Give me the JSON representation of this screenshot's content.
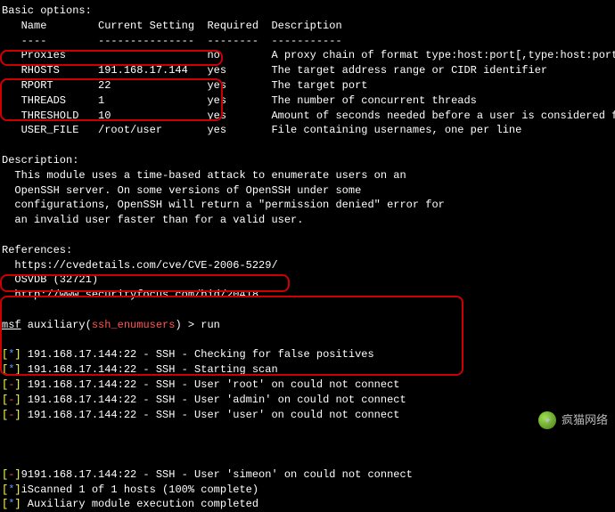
{
  "header": {
    "title": "Basic options:",
    "cols": {
      "name": "Name",
      "setting": "Current Setting",
      "required": "Required",
      "desc": "Description"
    },
    "rule": {
      "name": "----",
      "setting": "---------------",
      "required": "--------",
      "desc": "-----------"
    }
  },
  "options": [
    {
      "name": "Proxies",
      "setting": "",
      "required": "no",
      "desc": "A proxy chain of format type:host:port[,type:host:port][...]"
    },
    {
      "name": "RHOSTS",
      "setting": "191.168.17.144",
      "required": "yes",
      "desc": "The target address range or CIDR identifier"
    },
    {
      "name": "RPORT",
      "setting": "22",
      "required": "yes",
      "desc": "The target port"
    },
    {
      "name": "THREADS",
      "setting": "1",
      "required": "yes",
      "desc": "The number of concurrent threads"
    },
    {
      "name": "THRESHOLD",
      "setting": "10",
      "required": "yes",
      "desc": "Amount of seconds needed before a user is considered found"
    },
    {
      "name": "USER_FILE",
      "setting": "/root/user",
      "required": "yes",
      "desc": "File containing usernames, one per line"
    }
  ],
  "description": {
    "heading": "Description:",
    "lines": [
      "  This module uses a time-based attack to enumerate users on an",
      "  OpenSSH server. On some versions of OpenSSH under some",
      "  configurations, OpenSSH will return a \"permission denied\" error for",
      "  an invalid user faster than for a valid user."
    ]
  },
  "references": {
    "heading": "References:",
    "lines": [
      "  https://cvedetails.com/cve/CVE-2006-5229/",
      "  OSVDB (32721)",
      "  http://www.securityfocus.com/bid/20418"
    ]
  },
  "prompt": {
    "msf": "msf",
    "aux": " auxiliary(",
    "module": "ssh_enumusers",
    "close": ") ",
    "gt": ">",
    "cmd": " run"
  },
  "output": [
    {
      "mark": "[*]",
      "text": " 191.168.17.144:22 - SSH - Checking for false positives"
    },
    {
      "mark": "[*]",
      "text": " 191.168.17.144:22 - SSH - Starting scan"
    },
    {
      "mark": "[-]",
      "text": " 191.168.17.144:22 - SSH - User 'root' on could not connect"
    },
    {
      "mark": "[-]",
      "text": " 191.168.17.144:22 - SSH - User 'admin' on could not connect"
    },
    {
      "mark": "[-]",
      "text": " 191.168.17.144:22 - SSH - User 'user' on could not connect"
    }
  ],
  "tail": [
    {
      "mark": "[-]",
      "pfx": "9",
      "text": "191.168.17.144:22 - SSH - User 'simeon' on could not connect"
    },
    {
      "mark": "[*]",
      "pfx": "i",
      "text": "Scanned 1 of 1 hosts (100% complete)"
    },
    {
      "mark": "[*]",
      "pfx": " ",
      "text": "Auxiliary module execution completed"
    }
  ],
  "watermark": "疯猫网络"
}
